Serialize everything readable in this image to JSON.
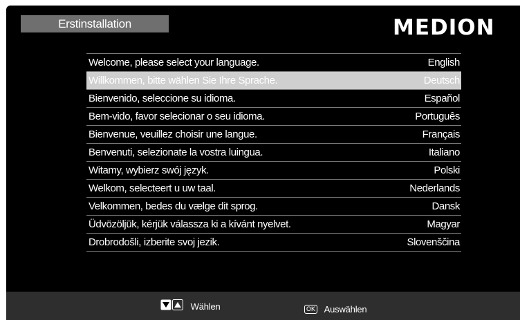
{
  "header": {
    "title": "Erstinstallation",
    "logo": "MEDION"
  },
  "language_list": {
    "selected_index": 1,
    "items": [
      {
        "message": "Welcome, please select your language.",
        "language": "English"
      },
      {
        "message": "Willkommen, bitte wählen Sie Ihre Sprache.",
        "language": "Deutsch"
      },
      {
        "message": "Bienvenido, seleccione su idioma.",
        "language": "Español"
      },
      {
        "message": "Bem-vido, favor selecionar o seu idioma.",
        "language": "Português"
      },
      {
        "message": "Bienvenue, veuillez choisir une langue.",
        "language": "Français"
      },
      {
        "message": "Benvenuti, selezionate la vostra luingua.",
        "language": "Italiano"
      },
      {
        "message": "Witamy, wybierz swój język.",
        "language": "Polski"
      },
      {
        "message": "Welkom, selecteert u uw taal.",
        "language": "Nederlands"
      },
      {
        "message": "Velkommen, bedes du vælge dit sprog.",
        "language": "Dansk"
      },
      {
        "message": "Üdvözöljük, kérjük válassza ki a kívánt nyelvet.",
        "language": "Magyar"
      },
      {
        "message": "Drobrodošli, izberite svoj jezik.",
        "language": "Slovenščina"
      }
    ]
  },
  "footer": {
    "navigate_label": "Wählen",
    "navigate_icons": [
      "down-arrow-key-icon",
      "up-arrow-key-icon"
    ],
    "ok_key": "OK",
    "ok_label": "Auswählen"
  },
  "colors": {
    "background": "#000000",
    "title_bar": "#6f6f6f",
    "selected_row": "#cfcfcf",
    "footer": "#2e2e2e",
    "divider": "#7a7a7a"
  }
}
